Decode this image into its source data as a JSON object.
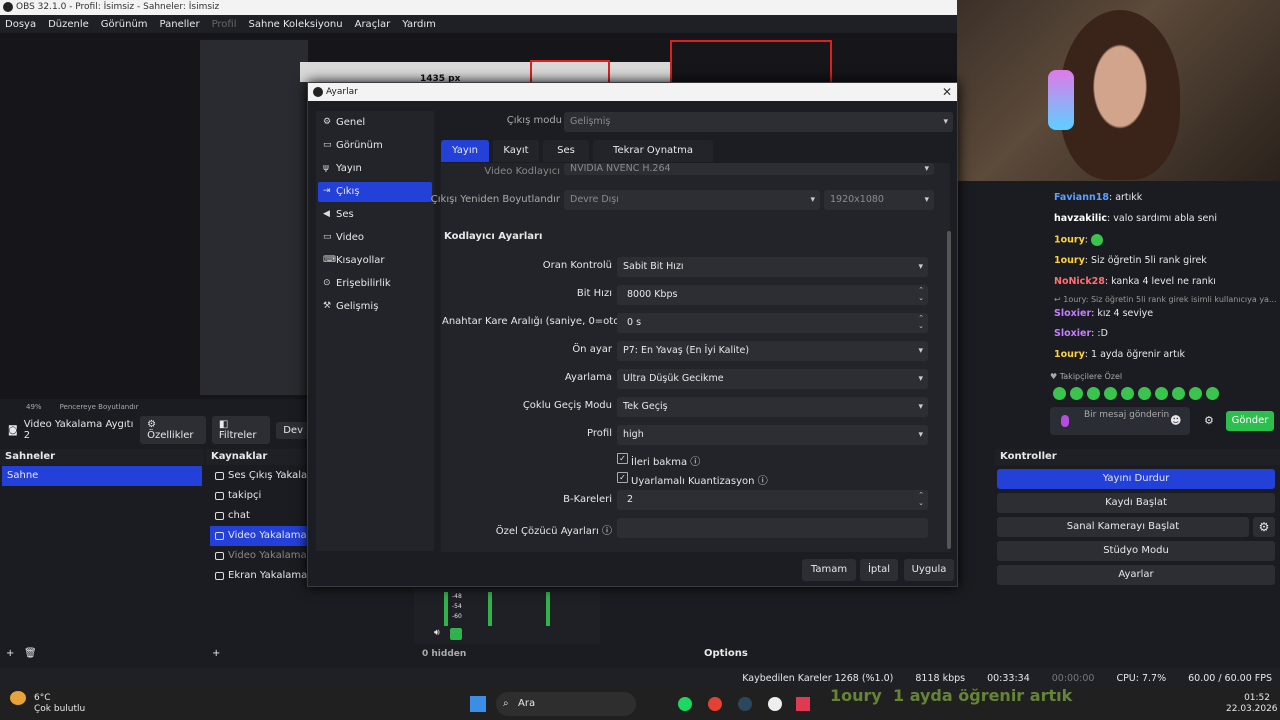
{
  "window": {
    "title": "OBS 32.1.0 - Profil: İsimsiz - Sahneler: İsimsiz"
  },
  "menu": [
    {
      "label": "Dosya"
    },
    {
      "label": "Düzenle"
    },
    {
      "label": "Görünüm"
    },
    {
      "label": "Paneller"
    },
    {
      "label": "Profil",
      "disabled": true
    },
    {
      "label": "Sahne Koleksiyonu"
    },
    {
      "label": "Araçlar"
    },
    {
      "label": "Yardım"
    }
  ],
  "preview": {
    "zoom": "49%",
    "resize_label": "Pencereye Boyutlandır",
    "overlay_px": "1435 px"
  },
  "source_toolbar": {
    "source": "Video Yakalama Aygıtı 2",
    "props": "Özellikler",
    "filters": "Filtreler",
    "deactivate": "Dev"
  },
  "scenes": {
    "header": "Sahneler",
    "items": [
      "Sahne"
    ]
  },
  "sources": {
    "header": "Kaynaklar",
    "items": [
      "Ses Çıkış Yakalayıcısı",
      "takipçi",
      "chat",
      "Video Yakalama Aygıtı",
      "Video Yakalama Aygıtı",
      "Ekran Yakalama"
    ]
  },
  "controls": {
    "header": "Kontroller",
    "buttons": [
      "Yayını Durdur",
      "Kaydı Başlat",
      "Sanal Kamerayı Başlat",
      "Stüdyo Modu",
      "Ayarlar"
    ]
  },
  "mixer": {
    "hidden": "0 hidden",
    "options": "Options",
    "levels": [
      "-48",
      "-54",
      "-60"
    ]
  },
  "chat": {
    "lines": [
      {
        "user": "Faviann18",
        "color": "#5aa0ff",
        "text": "artıkk"
      },
      {
        "user": "havzakilic",
        "color": "#ffffff",
        "text": "valo sardımı abla seni"
      },
      {
        "user": "1oury",
        "color": "#ffd23a",
        "text": ""
      },
      {
        "user": "1oury",
        "color": "#ffd23a",
        "text": "Siz öğretin 5li rank girek"
      },
      {
        "user": "NoNick28",
        "color": "#ff7070",
        "text": "kanka 4 level ne rankı"
      },
      {
        "user": "",
        "color": "#999",
        "text": "↩ 1oury: Siz öğretin 5li rank girek isimli kullanıcıya ya..."
      },
      {
        "user": "Sloxier",
        "color": "#c67dff",
        "text": "kız 4 seviye"
      },
      {
        "user": "Sloxier",
        "color": "#c67dff",
        "text": ":D"
      },
      {
        "user": "1oury",
        "color": "#ffd23a",
        "text": "1 ayda öğrenir artık"
      }
    ],
    "followers_only": "♥ Takipçilere Özel",
    "input_placeholder": "Bir mesaj gönderin",
    "send": "Gönder"
  },
  "status": {
    "dropped": "Kaybedilen Kareler 1268 (%1.0)",
    "bitrate": "8118 kbps",
    "stream_time": "00:33:34",
    "rec_time": "00:00:00",
    "cpu": "CPU: 7.7%",
    "fps": "60.00 / 60.00 FPS"
  },
  "taskbar": {
    "weather_temp": "6°C",
    "weather_desc": "Çok bulutlu",
    "search": "Ara",
    "time": "01:52",
    "date": "22.03.2026"
  },
  "overlay_chat": {
    "user": "1oury",
    "text": "1 ayda öğrenir artık"
  },
  "dialog": {
    "title": "Ayarlar",
    "sidebar": [
      "Genel",
      "Görünüm",
      "Yayın",
      "Çıkış",
      "Ses",
      "Video",
      "Kısayollar",
      "Erişebilirlik",
      "Gelişmiş"
    ],
    "sidebar_icons": [
      "⚙",
      "▭",
      "ψ",
      "⇥",
      "◀",
      "▭",
      "⌨",
      "⊙",
      "⚒"
    ],
    "output_mode_label": "Çıkış modu",
    "output_mode": "Gelişmiş",
    "tabs": [
      "Yayın",
      "Kayıt",
      "Ses",
      "Tekrar Oynatma Arabelleği"
    ],
    "encoder_label": "Video Kodlayıcı",
    "encoder": "NVIDIA NVENC H.264",
    "rescale_label": "Çıkışı Yeniden Boyutlandır",
    "rescale": "Devre Dışı",
    "rescale_res": "1920x1080",
    "section": "Kodlayıcı Ayarları",
    "fields": [
      {
        "label": "Oran Kontrolü",
        "value": "Sabit Bit Hızı",
        "kind": "combo"
      },
      {
        "label": "Bit Hızı",
        "value": "8000 Kbps",
        "kind": "spin"
      },
      {
        "label": "Anahtar Kare Aralığı (saniye, 0=otomatik)",
        "value": "0 s",
        "kind": "spin"
      },
      {
        "label": "Ön ayar",
        "value": "P7: En Yavaş (En İyi Kalite)",
        "kind": "combo"
      },
      {
        "label": "Ayarlama",
        "value": "Ultra Düşük Gecikme",
        "kind": "combo"
      },
      {
        "label": "Çoklu Geçiş Modu",
        "value": "Tek Geçiş",
        "kind": "combo"
      },
      {
        "label": "Profil",
        "value": "high",
        "kind": "combo"
      }
    ],
    "lookahead": "İleri bakma",
    "aq": "Uyarlamalı Kuantizasyon",
    "bframes_label": "B-Kareleri",
    "bframes": "2",
    "custom_label": "Özel Çözücü Ayarları",
    "ok": "Tamam",
    "cancel": "İptal",
    "apply": "Uygula"
  }
}
